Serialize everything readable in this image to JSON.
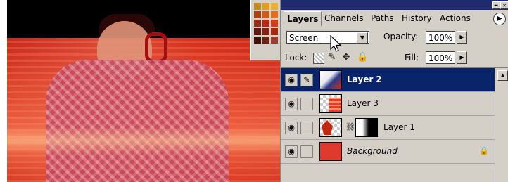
{
  "palette": {
    "tabs": [
      {
        "label": "Layers",
        "active": true
      },
      {
        "label": "Channels",
        "active": false
      },
      {
        "label": "Paths",
        "active": false
      },
      {
        "label": "History",
        "active": false
      },
      {
        "label": "Actions",
        "active": false
      }
    ],
    "blend_mode": "Screen",
    "opacity_label": "Opacity:",
    "opacity_value": "100%",
    "lock_label": "Lock:",
    "fill_label": "Fill:",
    "fill_value": "100%"
  },
  "layers": [
    {
      "name": "Layer 2",
      "selected": true,
      "visible": true,
      "thumbnail": "photo"
    },
    {
      "name": "Layer 3",
      "selected": false,
      "visible": true,
      "thumbnail": "red-stripes"
    },
    {
      "name": "Layer 1",
      "selected": false,
      "visible": true,
      "thumbnail": "leaf-with-mask"
    },
    {
      "name": "Background",
      "selected": false,
      "visible": true,
      "thumbnail": "solid-red",
      "locked": true
    }
  ],
  "colors": {
    "title_bar": "#1f2b6e",
    "selection": "#0a246a",
    "panel": "#d4d0c8",
    "background_layer": "#e03a2e"
  },
  "swatches": [
    "#c8861e",
    "#e09a2a",
    "#e8b040",
    "#b04010",
    "#d05818",
    "#e07020",
    "#903018",
    "#b82818",
    "#d04020",
    "#601810",
    "#882010",
    "#a82810",
    "#401008",
    "#702010",
    "#984030"
  ]
}
